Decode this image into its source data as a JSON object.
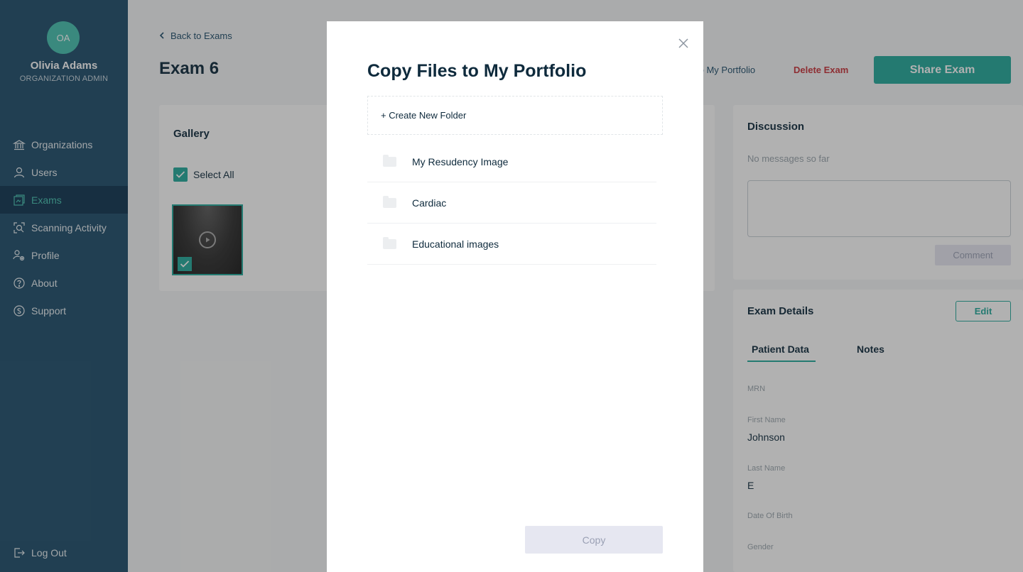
{
  "sidebar": {
    "avatar_initials": "OA",
    "user_name": "Olivia Adams",
    "user_role": "ORGANIZATION ADMIN",
    "items": [
      {
        "label": "Organizations",
        "icon": "bank-icon"
      },
      {
        "label": "Users",
        "icon": "user-icon"
      },
      {
        "label": "Exams",
        "icon": "exams-icon",
        "active": true
      },
      {
        "label": "Scanning Activity",
        "icon": "scan-search-icon"
      },
      {
        "label": "Profile",
        "icon": "profile-settings-icon"
      },
      {
        "label": "About",
        "icon": "help-circle-icon"
      },
      {
        "label": "Support",
        "icon": "support-icon"
      }
    ],
    "logout_label": "Log Out"
  },
  "header": {
    "back_label": "Back to Exams",
    "title": "Exam 6",
    "copy_link_label": "to My Portfolio",
    "delete_label": "Delete Exam",
    "share_label": "Share Exam"
  },
  "gallery": {
    "title": "Gallery",
    "select_all_label": "Select All"
  },
  "discussion": {
    "title": "Discussion",
    "empty_text": "No messages so far",
    "comment_label": "Comment"
  },
  "exam_details": {
    "title": "Exam Details",
    "edit_label": "Edit",
    "tabs": [
      "Patient Data",
      "Notes"
    ],
    "fields": {
      "mrn_label": "MRN",
      "first_name_label": "First Name",
      "first_name_value": "Johnson",
      "last_name_label": "Last Name",
      "last_name_value": "E",
      "dob_label": "Date Of Birth",
      "gender_label": "Gender"
    }
  },
  "modal": {
    "title": "Copy Files to My Portfolio",
    "create_folder_label": "+ Create New Folder",
    "folders": [
      "My Resudency Image",
      "Cardiac",
      "Educational images"
    ],
    "copy_label": "Copy"
  },
  "colors": {
    "sidebar": "#1e4d6b",
    "accent": "#23a99b",
    "danger": "#c8333a"
  }
}
